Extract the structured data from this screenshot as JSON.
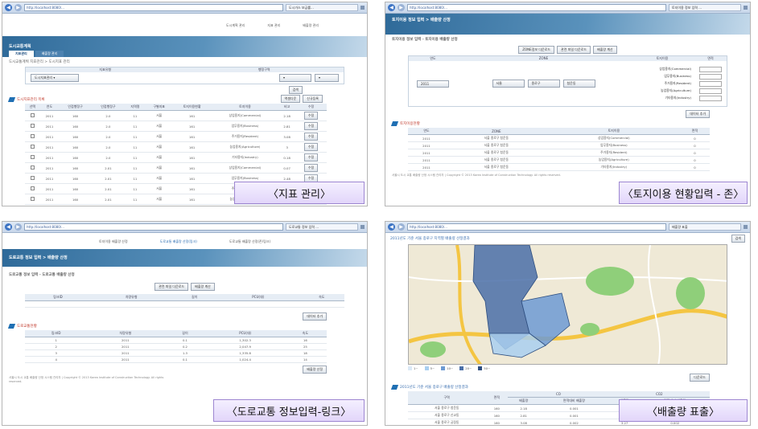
{
  "captions": {
    "p1": "〈지표 관리〉",
    "p2": "〈토지이용 현황입력 - 존〉",
    "p3": "〈도로교통 정보입력-링크〉",
    "p4": "〈배출량 표출〉"
  },
  "common": {
    "address": "http://localhost:8080/...",
    "nav_back": "◀",
    "nav_fwd": "▶"
  },
  "p1": {
    "tab": "도시가스 보급률...",
    "banner_title": "도시교통계획",
    "top_links": [
      "도시계획 관리",
      "지표 관리",
      "배출량 관리"
    ],
    "subtab_active": "지표관리",
    "subtab_other": "배출량 관리",
    "breadcrumb": "도시교통계획 지표관리 > 도시지표 관리",
    "filter_left_label": "지표유형",
    "filter_right_label": "행정구역",
    "filter_left_value": "도시지표관리 ▾",
    "search_button": "검색",
    "section_title": "도시지표관리 목록",
    "action_buttons": [
      "엑셀다운",
      "신규등록"
    ],
    "columns": [
      "선택",
      "연도",
      "인접행정구",
      "인접행정구",
      "지역명",
      "구별지표",
      "토지이용현황",
      "토지이용",
      "비고",
      "수정"
    ],
    "rows": [
      [
        "2011",
        "160",
        "2.0",
        "11",
        "서울",
        "161",
        "상업용지(Commercial)",
        "2.18"
      ],
      [
        "2011",
        "160",
        "2.0",
        "11",
        "서울",
        "161",
        "업무용지(Business)",
        "2.81"
      ],
      [
        "2011",
        "160",
        "2.0",
        "11",
        "서울",
        "161",
        "주거용지(Resident)",
        "3.08"
      ],
      [
        "2011",
        "160",
        "2.0",
        "11",
        "서울",
        "161",
        "농업용지(Agriculture)",
        "3"
      ],
      [
        "2011",
        "160",
        "2.0",
        "11",
        "서울",
        "161",
        "기타용지(Industry)",
        "0.18"
      ],
      [
        "2011",
        "160",
        "2.01",
        "11",
        "서울",
        "161",
        "상업용지(Commercial)",
        "0.07"
      ],
      [
        "2011",
        "160",
        "2.01",
        "11",
        "서울",
        "161",
        "업무용지(Business)",
        "2.48"
      ],
      [
        "2011",
        "160",
        "2.01",
        "11",
        "서울",
        "161",
        "주거용지(Resident)",
        "0.01"
      ],
      [
        "2011",
        "160",
        "2.01",
        "11",
        "서울",
        "161",
        "농업용지(Agriculture)",
        "1"
      ],
      [
        "2011",
        "160",
        "2.01",
        "11",
        "서울",
        "161",
        "기타용지(Industry)",
        "0.5"
      ]
    ],
    "edit_label": "수정"
  },
  "p2": {
    "tab": "토지이용 정보 입력 ...",
    "banner_title": "토지이용 정보 입력 > 배출량 산정",
    "breadcrumb": "토지이용 정보 입력 - 토지이용 배출량 산정",
    "top_buttons": [
      "ZONE정보 다운로드",
      "관련 파일 다운로드",
      "배출량 계산"
    ],
    "columns": [
      "연도",
      "ZONE",
      "토지이용",
      "면적"
    ],
    "year_value": "2011",
    "zone_values": [
      "서울",
      "종로구",
      "청운동"
    ],
    "land_uses": [
      "상업용지(Commercial)",
      "업무용지(Business)",
      "주거용지(Resident)",
      "농업용지(Agriculture)",
      "기타용지(Industry)"
    ],
    "calc_button": "데이터 추가",
    "section_title": "토지이용현황",
    "list_columns": [
      "연도",
      "ZONE",
      "토지이용",
      "면적"
    ],
    "list_rows": [
      [
        "2011",
        "서울 종로구 청운동",
        "상업용지(Commercial)",
        "0"
      ],
      [
        "2011",
        "서울 종로구 청운동",
        "업무용지(Business)",
        "0"
      ],
      [
        "2011",
        "서울 종로구 청운동",
        "주거용지(Resident)",
        "0"
      ],
      [
        "2011",
        "서울 종로구 청운동",
        "농업용지(Agriculture)",
        "0"
      ],
      [
        "2011",
        "서울 종로구 청운동",
        "기타용지(Industry)",
        "0"
      ]
    ],
    "footer": "서울시 도시 교통 배출량 산정 시스템 관리자 | Copyright © 2013 Korea Institute of Construction Technology. All rights reserved."
  },
  "p3": {
    "tab": "도로교통 정보 입력 ...",
    "top_links": [
      "토지이용 배출량 산정",
      "도로교통 배출량 산정(링크)",
      "도로교통 배출량 산정(존/링크)"
    ],
    "banner_title": "도로교통 정보 입력 > 배출량 산정",
    "breadcrumb": "도로교통 정보 입력 - 도로교통 배출량 산정",
    "top_buttons": [
      "관련 파일 다운로드",
      "배출량 계산"
    ],
    "columns": [
      "링크ID",
      "차량유형",
      "길이",
      "PCU(대)",
      "속도"
    ],
    "calc_button": "데이터 추가",
    "section_title": "도로교통현황",
    "list_columns": [
      "링크ID",
      "차량유형",
      "길이",
      "PCU(대)",
      "속도"
    ],
    "list_rows": [
      [
        "1",
        "2011",
        "0.1",
        "1,302.3",
        "16"
      ],
      [
        "2",
        "2011",
        "0.2",
        "2,047.9",
        "25"
      ],
      [
        "3",
        "2011",
        "1.3",
        "1,335.8",
        "18"
      ],
      [
        "4",
        "2011",
        "0.1",
        "1,024.4",
        "14"
      ]
    ],
    "bottom_button": "배출량 산정",
    "footer": "서울시 도시 교통 배출량 산정 시스템 관리자 | Copyright © 2013 Korea Institute of Construction Technology. All rights reserved."
  },
  "p4": {
    "tab": "배출량 표출",
    "map_title": "2011년도 기준 서울 종로구 지역별 배출량 산정결과",
    "map_button": "검색",
    "legend": [
      "1~",
      "5~",
      "10~",
      "20~",
      "50~"
    ],
    "download_button": "다운로드",
    "table_title": "2011년도 기준 서울 종로구 배출량 산정결과",
    "columns": [
      "구역",
      "면적",
      "CO",
      "CO2"
    ],
    "sub_columns": [
      "배출량",
      "면적대비 배출량",
      "배출량",
      "면적대비 배출량"
    ],
    "rows": [
      [
        "서울 종로구 청운동",
        "160",
        "2.18",
        "0.001",
        "2.54",
        "0.001"
      ],
      [
        "서울 종로구 신교동",
        "160",
        "2.81",
        "0.001",
        "3.01",
        "0.002"
      ],
      [
        "서울 종로구 궁정동",
        "160",
        "3.08",
        "0.002",
        "3.27",
        "0.002"
      ],
      [
        "서울 종로구 효자동",
        "160",
        "0.18",
        "0.000",
        "0.22",
        "0.000"
      ]
    ],
    "colors": {
      "zone_dark": "#4a6fa8",
      "zone_mid": "#6d9ad3",
      "zone_light": "#a9cff0",
      "green": "#8fcf7a",
      "road": "#f4c542"
    }
  }
}
